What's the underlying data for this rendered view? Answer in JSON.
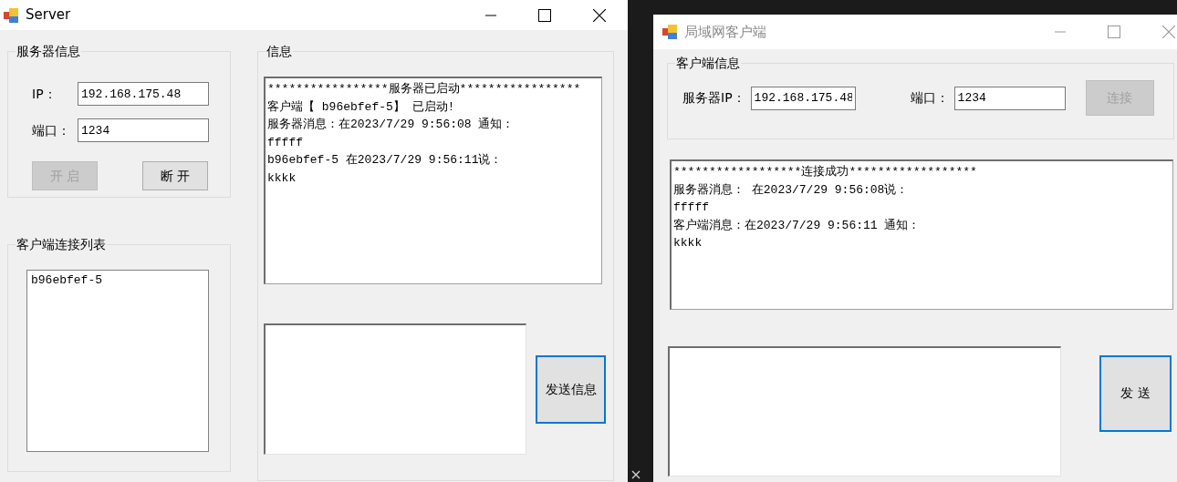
{
  "server_window": {
    "title": "Server",
    "active": true,
    "server_info": {
      "title": "服务器信息",
      "ip_label": "IP：",
      "ip_value": "192.168.175.48",
      "port_label": "端口：",
      "port_value": "1234",
      "buttons": [
        {
          "label": "开 启",
          "disabled": true
        },
        {
          "label": "断 开",
          "disabled": false
        }
      ]
    },
    "client_list": {
      "title": "客户端连接列表",
      "items": [
        "b96ebfef-5"
      ]
    },
    "messages": {
      "title": "信息",
      "log": [
        "*****************服务器已启动*****************",
        "客户端【 b96ebfef-5】 已启动!",
        "服务器消息：在2023/7/29 9:56:08 通知：",
        "fffff",
        "b96ebfef-5 在2023/7/29 9:56:11说：",
        "kkkk"
      ],
      "send_button": {
        "label": "发送信息",
        "focused": true
      }
    }
  },
  "client_window": {
    "title": "局域网客户端",
    "active": false,
    "client_info": {
      "title": "客户端信息",
      "ip_label": "服务器IP：",
      "ip_value": "192.168.175.48",
      "port_label": "端口：",
      "port_value": "1234",
      "connect_button": {
        "label": "连接",
        "disabled": true
      }
    },
    "log": [
      "******************连接成功******************",
      "服务器消息： 在2023/7/29 9:56:08说：",
      "fffff",
      "客户端消息：在2023/7/29 9:56:11 通知：",
      "kkkk"
    ],
    "send_button": {
      "label": "发 送",
      "focused": true
    }
  }
}
